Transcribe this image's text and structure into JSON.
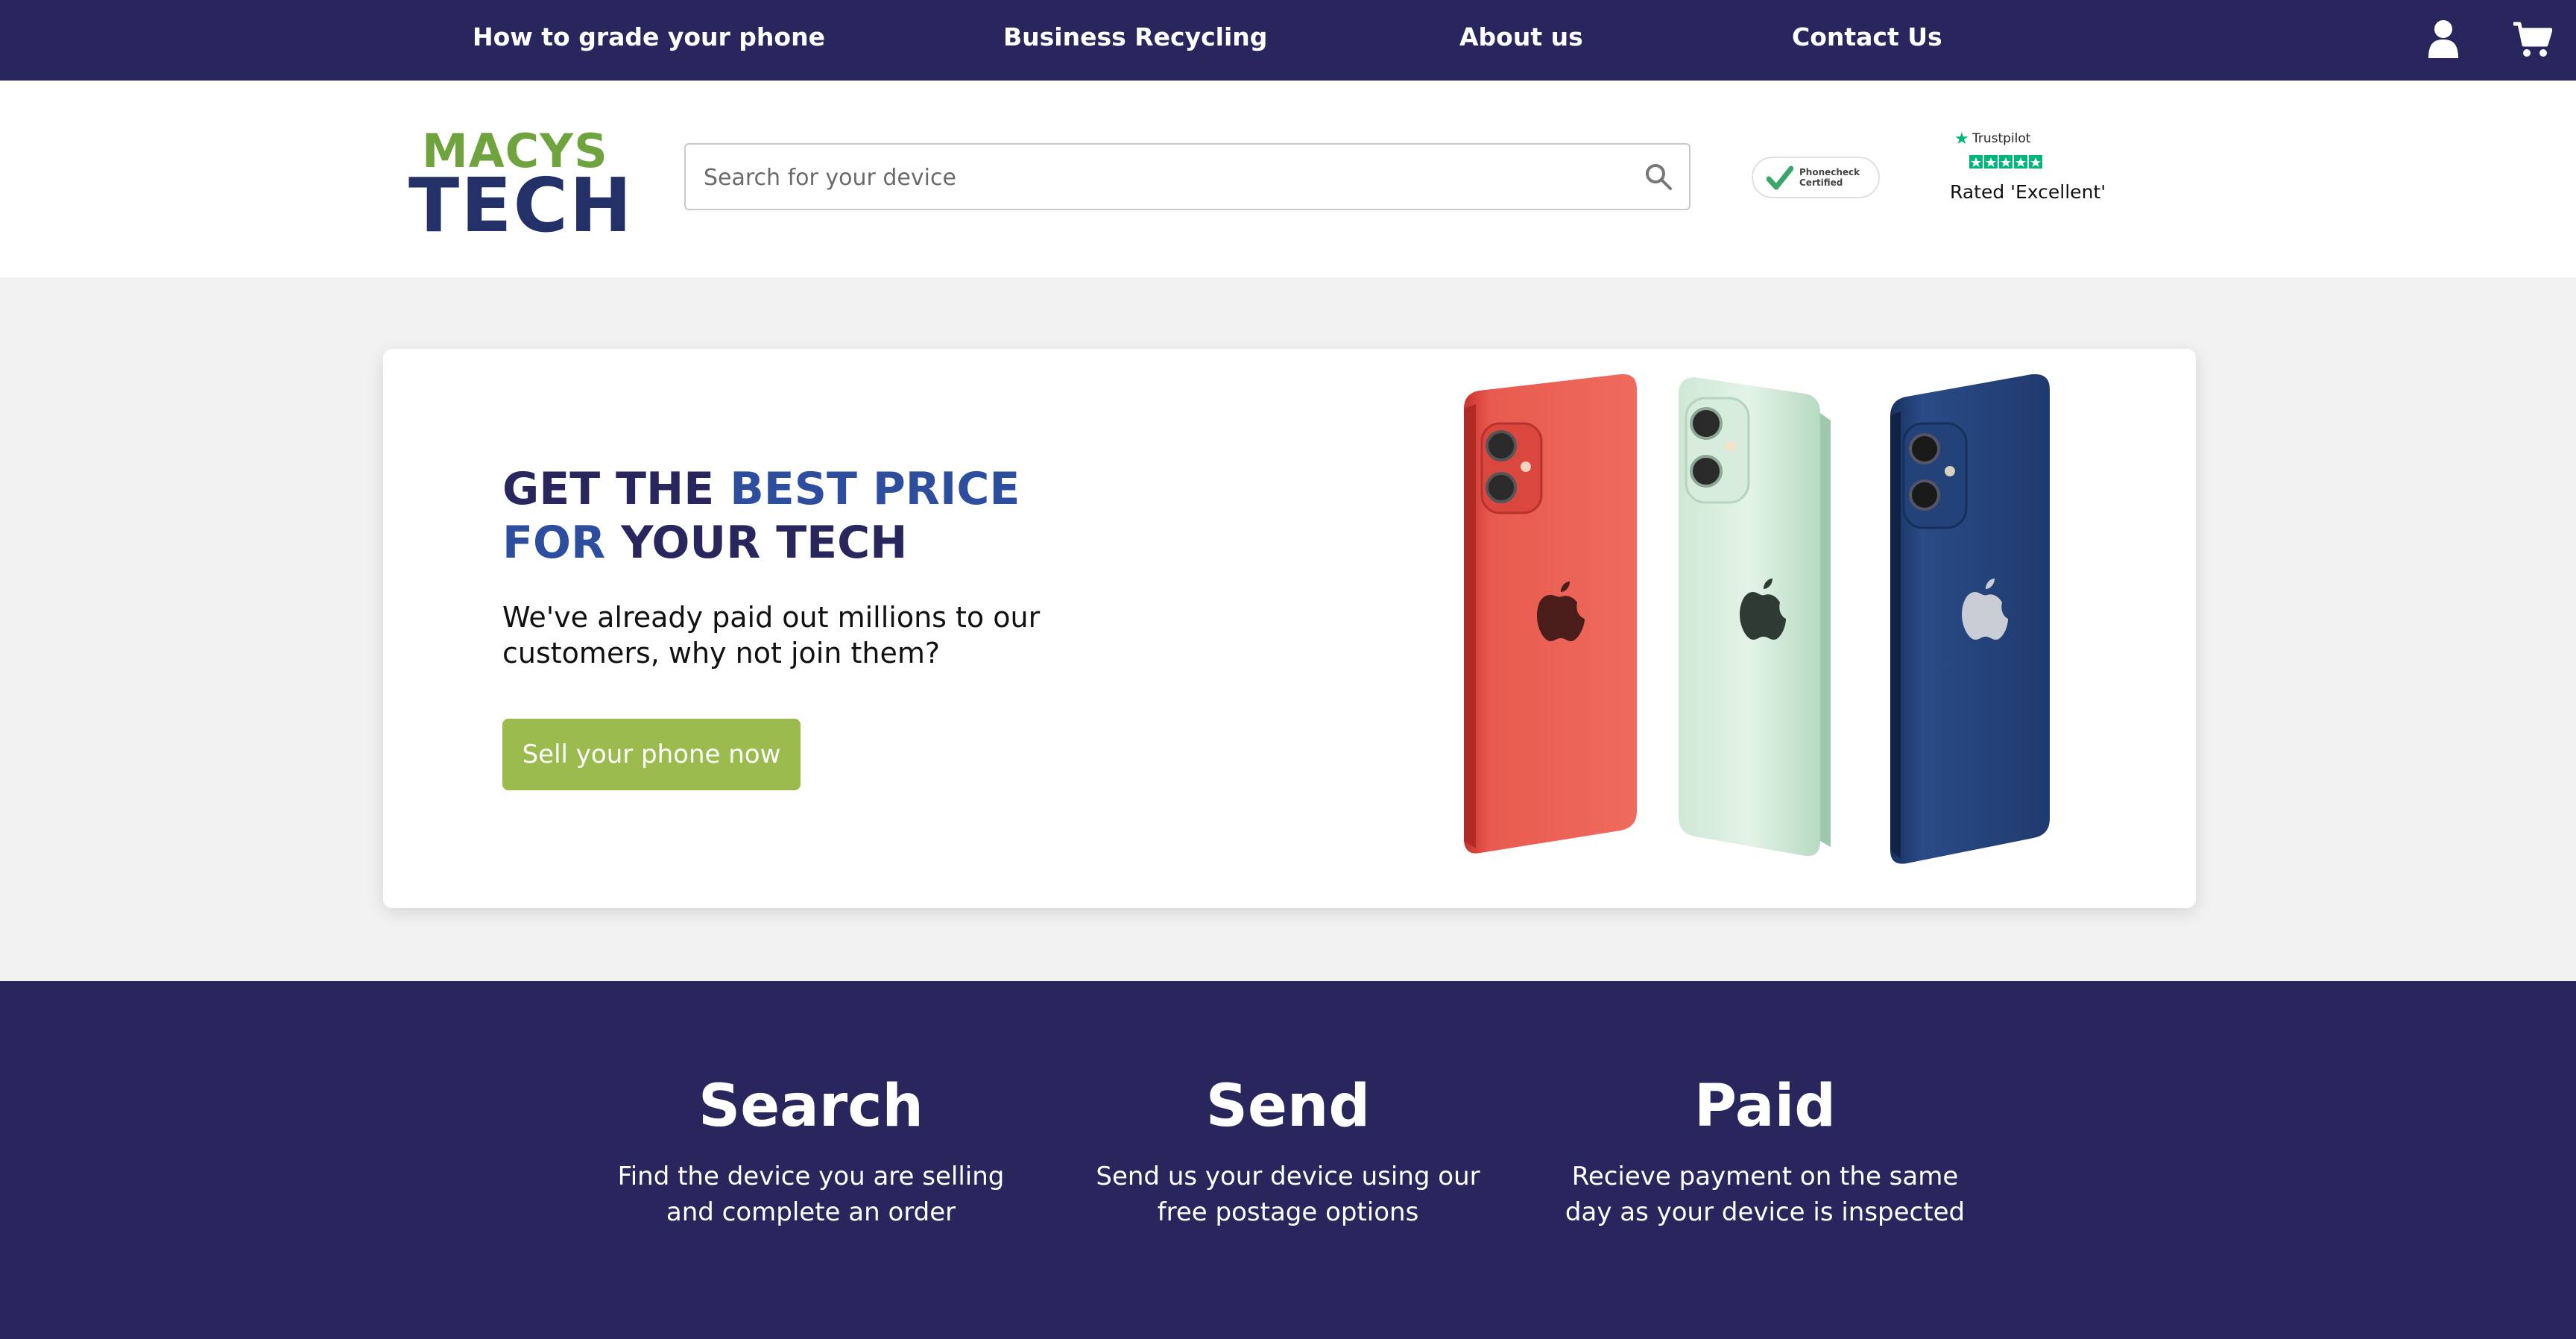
{
  "nav": {
    "links": [
      "How to grade your phone",
      "Business Recycling",
      "About us",
      "Contact Us"
    ]
  },
  "header": {
    "logo_top": "MACYS",
    "logo_bottom": "TECH",
    "search_placeholder": "Search for your device",
    "phonecheck_text": "Phonecheck Certified",
    "trustpilot_name": "Trustpilot",
    "trustpilot_rating_text": "Rated 'Excellent'"
  },
  "hero": {
    "title_part1": "GET THE ",
    "title_accent": "BEST PRICE FOR",
    "title_part2": " YOUR TECH",
    "subtitle": "We've already paid out millions to our customers, why not join them?",
    "cta": "Sell your phone now"
  },
  "steps": [
    {
      "title": "Search",
      "desc": "Find the device you are selling and complete an order"
    },
    {
      "title": "Send",
      "desc": "Send us your device using our free postage options"
    },
    {
      "title": "Paid",
      "desc": "Recieve payment on the same day as your device is inspected"
    }
  ],
  "colors": {
    "nav_bg": "#28265c",
    "brand_green": "#6ea33d",
    "brand_blue": "#243168",
    "cta_green": "#9bbb4e",
    "accent_blue": "#2d4d9e"
  },
  "icons": [
    "user-icon",
    "cart-icon",
    "search-icon",
    "check-icon",
    "trustpilot-star-icon"
  ]
}
